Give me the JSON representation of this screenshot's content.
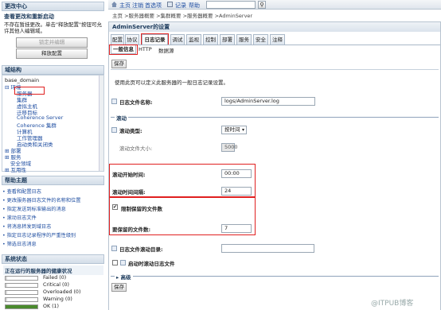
{
  "change_center": {
    "header": "更改中心",
    "title": "查看更改和重新启动",
    "desc": "不存在暂挂更改。单击\"释放配置\"按钮可允许其他人编辑域。",
    "lock_btn": "锁定并编辑",
    "release_btn": "释放配置"
  },
  "domain_structure": {
    "header": "域结构",
    "items": [
      "base_domain",
      "⊟ 环境",
      "服务器",
      "集群",
      "虚拟主机",
      "迁移目标",
      "Coherence Server",
      "Coherence 集群",
      "计算机",
      "工作管理器",
      "启动类和关闭类",
      "⊞ 部署",
      "⊞ 服务",
      "安全领域",
      "⊞ 互用性"
    ]
  },
  "help": {
    "header": "帮助主题",
    "items": [
      "查看和配置日志",
      "更改服务器日志文件的名称和位置",
      "指定发送到标准输出的消息",
      "滚动日志文件",
      "将消息转发到域日志",
      "指定日志记录程序的严重性级别",
      "筛选日志消息"
    ]
  },
  "system_status": {
    "header": "系统状态",
    "title": "正在运行的服务器的健康状况",
    "rows": [
      {
        "label": "Failed (0)",
        "color": "#d9d9d9"
      },
      {
        "label": "Critical (0)",
        "color": "#d9d9d9"
      },
      {
        "label": "Overloaded (0)",
        "color": "#d9d9d9"
      },
      {
        "label": "Warning (0)",
        "color": "#d9d9d9"
      },
      {
        "label": "OK (1)",
        "color": "#4a8a2c"
      }
    ]
  },
  "toolbar": {
    "items": [
      "主页",
      "注销",
      "首选项",
      "记录",
      "帮助"
    ]
  },
  "breadcrumb": "主页 >服务器概要 >集群概要 >服务器概要 >AdminServer",
  "page_title": "AdminServer的设置",
  "tabs": [
    "配置",
    "协议",
    "日志记录",
    "调试",
    "监视",
    "控制",
    "部署",
    "服务",
    "安全",
    "注释"
  ],
  "subtabs": [
    "一般信息",
    "HTTP",
    "数据源"
  ],
  "save_label": "保存",
  "intro": "使用此页可以定义此服务器的一般日志记录设置。",
  "fields": {
    "log_file_label": "日志文件名称:",
    "log_file_value": "logs/AdminServer.log",
    "rotation_section": "滚动",
    "rotation_type_label": "滚动类型:",
    "rotation_type_value": "按时间",
    "rotation_size_label": "滚动文件大小:",
    "rotation_size_value": "5000",
    "begin_time_label": "滚动开始时间:",
    "begin_time_value": "00:00",
    "interval_label": "滚动时间间隔:",
    "interval_value": "24",
    "limit_label": "限制保留的文件数",
    "files_label": "要保留的文件数:",
    "files_value": "7",
    "rotation_dir_label": "日志文件滚动目录:",
    "rotate_startup_label": "启动时滚动日志文件",
    "advanced_label": "高级"
  },
  "watermark": "@ITPUB博客"
}
